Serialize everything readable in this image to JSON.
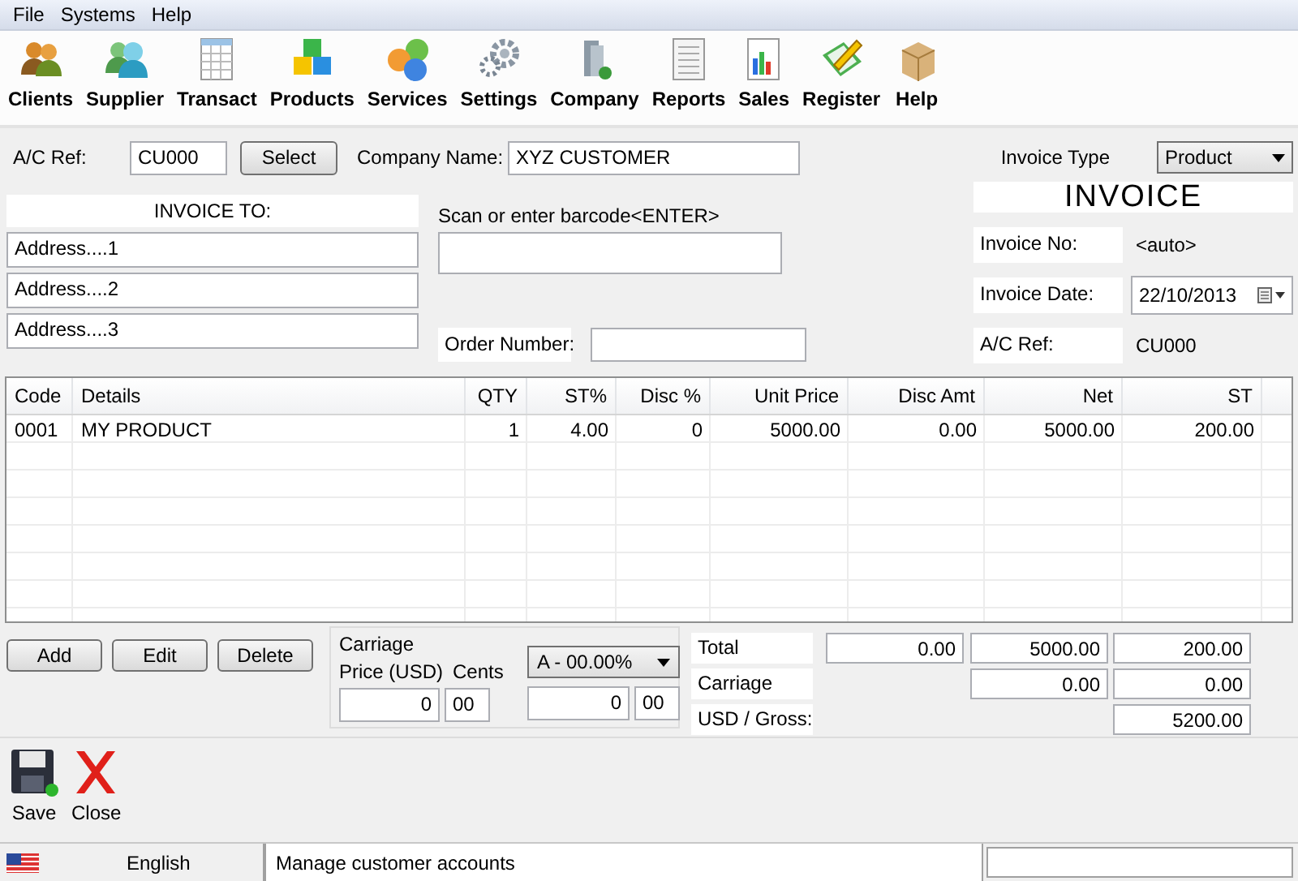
{
  "menu": [
    "File",
    "Systems",
    "Help"
  ],
  "toolbar": [
    "Clients",
    "Supplier",
    "Transact",
    "Products",
    "Services",
    "Settings",
    "Company",
    "Reports",
    "Sales",
    "Register",
    "Help"
  ],
  "header": {
    "ac_ref_label": "A/C Ref:",
    "ac_ref_value": "CU000",
    "select_button": "Select",
    "company_name_label": "Company Name:",
    "company_name_value": "XYZ CUSTOMER",
    "invoice_type_label": "Invoice Type",
    "invoice_type_value": "Product"
  },
  "invoice_to": {
    "title": "INVOICE TO:",
    "address_lines": [
      "Address....1",
      "Address....2",
      "Address....3"
    ]
  },
  "barcode": {
    "label": "Scan or enter barcode<ENTER>"
  },
  "order_number": {
    "label": "Order Number:"
  },
  "invoice_panel": {
    "title": "INVOICE",
    "fields": [
      {
        "label": "Invoice No:",
        "value": "<auto>",
        "kind": "text"
      },
      {
        "label": "Invoice Date:",
        "value": "22/10/2013",
        "kind": "date"
      },
      {
        "label": "A/C Ref:",
        "value": "CU000",
        "kind": "text"
      }
    ]
  },
  "table": {
    "columns": [
      "Code",
      "Details",
      "QTY",
      "ST%",
      "Disc %",
      "Unit Price",
      "Disc Amt",
      "Net",
      "ST"
    ],
    "rows": [
      [
        "0001",
        "MY PRODUCT",
        "1",
        "4.00",
        "0",
        "5000.00",
        "0.00",
        "5000.00",
        "200.00"
      ]
    ]
  },
  "buttons": [
    "Add",
    "Edit",
    "Delete"
  ],
  "carriage": {
    "title": "Carriage",
    "price_label": "Price (USD)",
    "cents_label": "Cents",
    "price_value": "0",
    "cents_value": "00",
    "tax_dropdown": "A - 00.00%",
    "tax_price_value": "0",
    "tax_cents_value": "00"
  },
  "totals": [
    {
      "label": "Total",
      "column_1": "0.00",
      "column_2": "5000.00",
      "column_3": "200.00"
    },
    {
      "label": "Carriage",
      "column_2": "0.00",
      "column_3": "0.00"
    },
    {
      "label": "USD / Gross:",
      "column_3": "5200.00"
    }
  ],
  "actions": [
    "Save",
    "Close"
  ],
  "status_bar": {
    "language": "English",
    "message": "Manage customer accounts"
  }
}
